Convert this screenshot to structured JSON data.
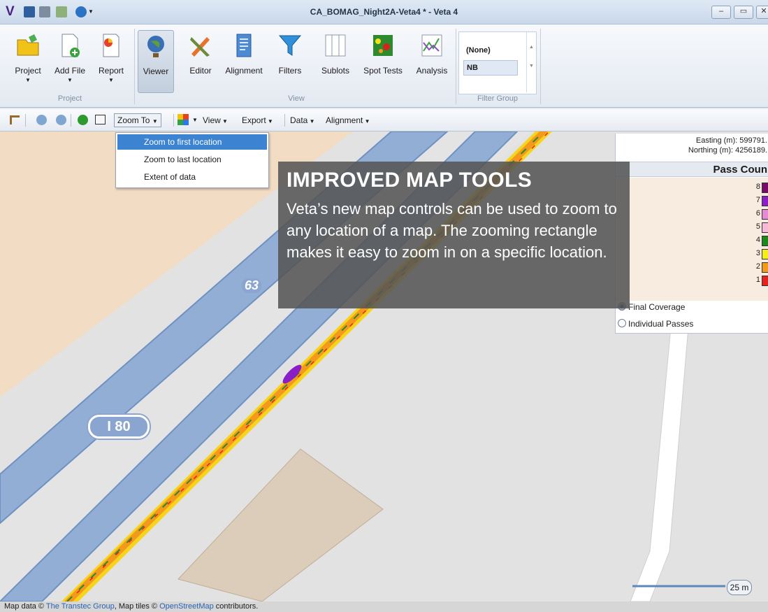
{
  "app": {
    "logo": "V",
    "title": "CA_BOMAG_Night2A-Veta4 * - Veta 4"
  },
  "window_controls": [
    "–",
    "▭",
    "✕"
  ],
  "ribbon": {
    "groups": {
      "project": "Project",
      "view": "View",
      "filter_group": "Filter Group"
    },
    "buttons": {
      "project": "Project",
      "add_file": "Add File",
      "report": "Report",
      "viewer": "Viewer",
      "editor": "Editor",
      "alignment": "Alignment",
      "filters": "Filters",
      "sublots": "Sublots",
      "spot_tests": "Spot Tests",
      "analysis": "Analysis"
    },
    "filter_gallery": [
      "(None)",
      "NB"
    ]
  },
  "map_toolbar": {
    "zoom_to": "Zoom To",
    "view": "View",
    "export": "Export",
    "data": "Data",
    "alignment": "Alignment"
  },
  "dropdown": [
    "Zoom to first location",
    "Zoom to last location",
    "Extent of data"
  ],
  "overlay": {
    "title": "IMPROVED MAP TOOLS",
    "body": "Veta’s new map controls can be used to zoom to any location of a map. The zooming rectangle makes it easy to zoom in on a specific location."
  },
  "legend": {
    "easting": "Easting (m): 599791.",
    "northing": "Northing (m): 4256189.",
    "title": "Pass Coun",
    "items": [
      {
        "num": "8",
        "color": "#7a0a6a"
      },
      {
        "num": "7",
        "color": "#8a1ec8"
      },
      {
        "num": "6",
        "color": "#e68ad6"
      },
      {
        "num": "5",
        "color": "#f7b9d8"
      },
      {
        "num": "4",
        "color": "#1b8a1b"
      },
      {
        "num": "3",
        "color": "#f4ee14"
      },
      {
        "num": "2",
        "color": "#f29a19"
      },
      {
        "num": "1",
        "color": "#e8231d"
      }
    ],
    "options": [
      "Final Coverage",
      "Individual Passes"
    ]
  },
  "map": {
    "route_63": "63",
    "route_i80": "I 80",
    "scale": "25 m",
    "attribution_pre": "Map data © ",
    "attribution_link1": "The Transtec Group",
    "attribution_mid": ", Map tiles © ",
    "attribution_link2": "OpenStreetMap",
    "attribution_post": " contributors."
  }
}
